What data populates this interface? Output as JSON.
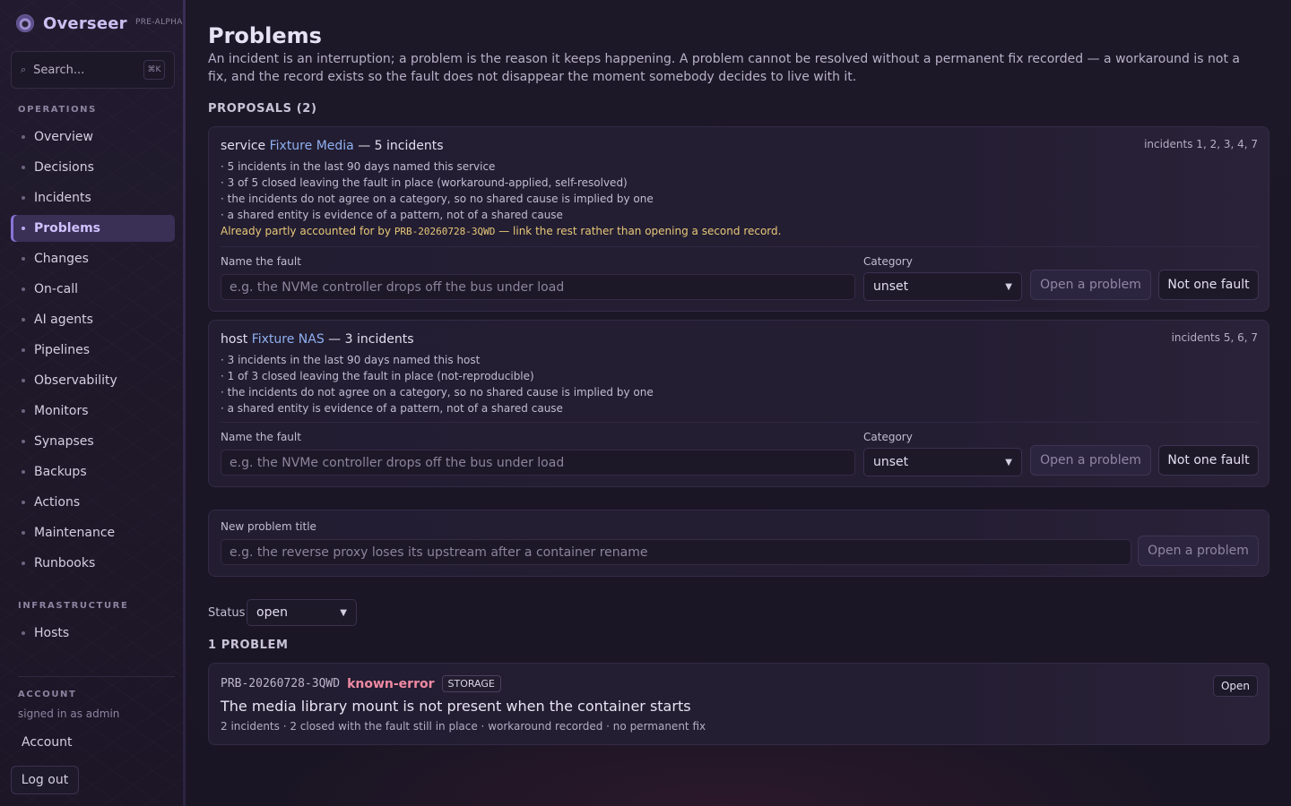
{
  "brand": {
    "name": "Overseer",
    "tag": "PRE-ALPHA"
  },
  "search": {
    "placeholder": "Search...",
    "shortcut": "⌘K"
  },
  "sidebar": {
    "operations_label": "OPERATIONS",
    "operations": [
      "Overview",
      "Decisions",
      "Incidents",
      "Problems",
      "Changes",
      "On-call",
      "AI agents",
      "Pipelines",
      "Observability",
      "Monitors",
      "Synapses",
      "Backups",
      "Actions",
      "Maintenance",
      "Runbooks"
    ],
    "active": "Problems",
    "infrastructure_label": "INFRASTRUCTURE",
    "infrastructure": [
      "Hosts"
    ],
    "account_label": "ACCOUNT",
    "signed_in": "signed in as admin",
    "account_link": "Account",
    "logout": "Log out"
  },
  "page": {
    "title": "Problems",
    "description": "An incident is an interruption; a problem is the reason it keeps happening. A problem cannot be resolved without a permanent fix recorded — a workaround is not a fix, and the record exists so the fault does not disappear the moment somebody decides to live with it."
  },
  "proposals": {
    "heading": "PROPOSALS (2)",
    "items": [
      {
        "kind": "service",
        "entity": "Fixture Media",
        "count_text": "— 5 incidents",
        "incidents": "incidents 1, 2, 3, 4, 7",
        "reasons": [
          "· 5 incidents in the last 90 days named this service",
          "· 3 of 5 closed leaving the fault in place (workaround-applied, self-resolved)",
          "· the incidents do not agree on a category, so no shared cause is implied by one",
          "· a shared entity is evidence of a pattern, not of a shared cause"
        ],
        "warning_pre": "Already partly accounted for by ",
        "warning_id": "PRB-20260728-3QWD",
        "warning_post": " — link the rest rather than opening a second record.",
        "name_label": "Name the fault",
        "name_placeholder": "e.g. the NVMe controller drops off the bus under load",
        "category_label": "Category",
        "category_value": "unset",
        "open_label": "Open a problem",
        "reject_label": "Not one fault"
      },
      {
        "kind": "host",
        "entity": "Fixture NAS",
        "count_text": "— 3 incidents",
        "incidents": "incidents 5, 6, 7",
        "reasons": [
          "· 3 incidents in the last 90 days named this host",
          "· 1 of 3 closed leaving the fault in place (not-reproducible)",
          "· the incidents do not agree on a category, so no shared cause is implied by one",
          "· a shared entity is evidence of a pattern, not of a shared cause"
        ],
        "name_label": "Name the fault",
        "name_placeholder": "e.g. the NVMe controller drops off the bus under load",
        "category_label": "Category",
        "category_value": "unset",
        "open_label": "Open a problem",
        "reject_label": "Not one fault"
      }
    ]
  },
  "new_problem": {
    "label": "New problem title",
    "placeholder": "e.g. the reverse proxy loses its upstream after a container rename",
    "button": "Open a problem"
  },
  "filter": {
    "label": "Status",
    "value": "open"
  },
  "problems": {
    "heading": "1 PROBLEM",
    "items": [
      {
        "id": "PRB-20260728-3QWD",
        "state": "known-error",
        "tag": "STORAGE",
        "title": "The media library mount is not present when the container starts",
        "meta": "2 incidents · 2 closed with the fault still in place · workaround recorded · no permanent fix",
        "open_label": "Open"
      }
    ]
  },
  "colors": {
    "accent": "#8a73d8",
    "link": "#8fb0f0",
    "warning": "#e8c879",
    "known_error": "#f08aa3"
  }
}
